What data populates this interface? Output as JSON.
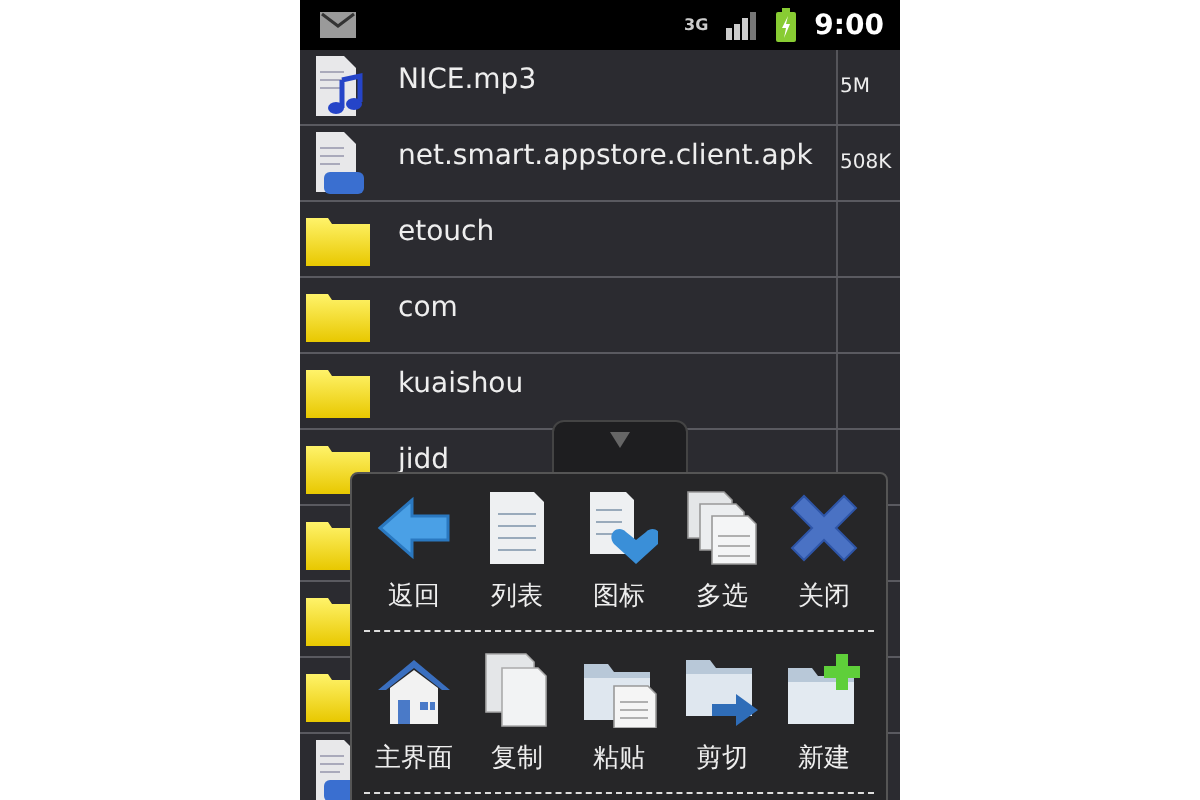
{
  "status_bar": {
    "network": "3G",
    "time": "9:00"
  },
  "files": [
    {
      "kind": "audio",
      "name": "NICE.mp3",
      "size": "5M"
    },
    {
      "kind": "apk",
      "name": "net.smart.appstore.client.apk",
      "size": "508K"
    },
    {
      "kind": "folder",
      "name": "etouch"
    },
    {
      "kind": "folder",
      "name": "com"
    },
    {
      "kind": "folder",
      "name": "kuaishou"
    },
    {
      "kind": "folder",
      "name": "jidd"
    },
    {
      "kind": "folder"
    },
    {
      "kind": "folder"
    },
    {
      "kind": "folder"
    },
    {
      "kind": "apk"
    }
  ],
  "menu": {
    "rows": [
      [
        {
          "kind": "back",
          "label": "返回"
        },
        {
          "kind": "list",
          "label": "列表"
        },
        {
          "kind": "icons",
          "label": "图标"
        },
        {
          "kind": "multi",
          "label": "多选"
        },
        {
          "kind": "close",
          "label": "关闭"
        }
      ],
      [
        {
          "kind": "home",
          "label": "主界面"
        },
        {
          "kind": "copy",
          "label": "复制"
        },
        {
          "kind": "paste",
          "label": "粘贴"
        },
        {
          "kind": "cut",
          "label": "剪切"
        },
        {
          "kind": "newfolder",
          "label": "新建"
        }
      ]
    ]
  }
}
